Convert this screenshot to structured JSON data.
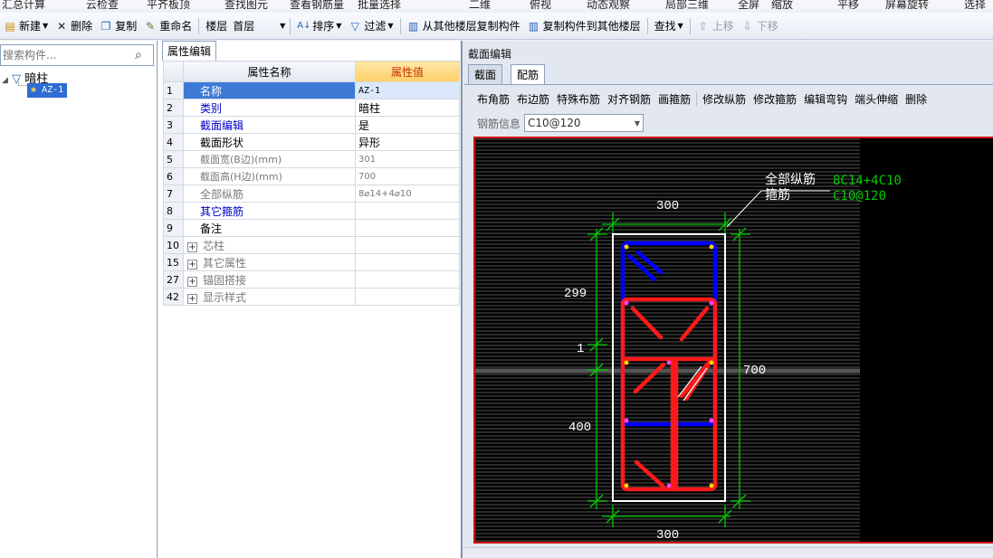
{
  "topbar": [
    "汇总计算",
    "云检查",
    "平齐板顶",
    "查找图元",
    "查看钢筋量",
    "批量选择",
    "二维",
    "俯视",
    "动态观察",
    "局部三维",
    "全屏",
    "缩放",
    "平移",
    "屏幕旋转",
    "选择"
  ],
  "toolbar": {
    "new": "新建",
    "delete": "删除",
    "copy": "复制",
    "rename": "重命名",
    "floor_label": "楼层",
    "floor_value": "首层",
    "sort": "排序",
    "filter": "过滤",
    "copy_from_floor": "从其他楼层复制构件",
    "copy_to_floor": "复制构件到其他楼层",
    "find": "查找",
    "move_up": "上移",
    "move_down": "下移"
  },
  "search": {
    "placeholder": "搜索构件..."
  },
  "tree": {
    "root": "暗柱",
    "child": "AZ-1"
  },
  "props": {
    "tab": "属性编辑",
    "col_name": "属性名称",
    "col_value": "属性值",
    "rows": [
      {
        "num": "1",
        "name": "名称",
        "value": "AZ-1"
      },
      {
        "num": "2",
        "name": "类别",
        "value": "暗柱"
      },
      {
        "num": "3",
        "name": "截面编辑",
        "value": "是"
      },
      {
        "num": "4",
        "name": "截面形状",
        "value": "异形"
      },
      {
        "num": "5",
        "name": "截面宽(B边)(mm)",
        "value": "301"
      },
      {
        "num": "6",
        "name": "截面高(H边)(mm)",
        "value": "700"
      },
      {
        "num": "7",
        "name": "全部纵筋",
        "value": "8⌀14+4⌀10"
      },
      {
        "num": "8",
        "name": "其它箍筋",
        "value": ""
      },
      {
        "num": "9",
        "name": "备注",
        "value": ""
      },
      {
        "num": "10",
        "name": "芯柱",
        "value": ""
      },
      {
        "num": "15",
        "name": "其它属性",
        "value": ""
      },
      {
        "num": "27",
        "name": "锚固搭接",
        "value": ""
      },
      {
        "num": "42",
        "name": "显示样式",
        "value": ""
      }
    ]
  },
  "section": {
    "title": "截面编辑",
    "tab_section": "截面",
    "tab_rebar": "配筋",
    "tools": [
      "布角筋",
      "布边筋",
      "特殊布筋",
      "对齐钢筋",
      "画箍筋",
      "修改纵筋",
      "修改箍筋",
      "编辑弯钩",
      "端头伸缩",
      "删除"
    ],
    "rebar_info_label": "钢筋信息",
    "rebar_info_value": "C10@120",
    "drawing": {
      "dim_top": "300",
      "dim_bottom": "300",
      "dim_left_top": "299",
      "dim_left_mid": "1",
      "dim_left_bottom": "400",
      "dim_right": "700",
      "callout_long": "全部纵筋",
      "callout_stirrup": "箍筋",
      "long_value": "8C14+4C10",
      "stirrup_value": "C10@120",
      "color_long": "#00cc00",
      "color_stirrup_red": "#ff1a1a",
      "color_stirrup_blue": "#0000ff"
    }
  }
}
